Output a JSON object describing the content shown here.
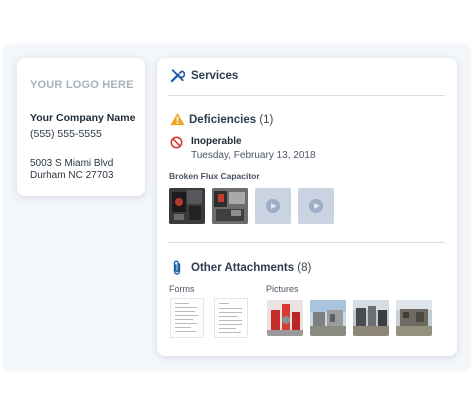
{
  "company": {
    "logo_placeholder": "YOUR LOGO HERE",
    "name": "Your Company Name",
    "phone": "(555) 555-5555",
    "address_line1": "5003 S Miami Blvd",
    "address_line2": "Durham NC 27703"
  },
  "services": {
    "title": "Services",
    "icon": "tools-icon"
  },
  "deficiencies": {
    "title": "Deficiencies",
    "count": "(1)",
    "icon": "warning-icon",
    "item": {
      "status": "Inoperable",
      "status_icon": "prohibited-icon",
      "date": "Tuesday, February 13, 2018",
      "label": "Broken Flux Capacitor",
      "media": [
        "photo",
        "photo",
        "video",
        "video"
      ]
    }
  },
  "attachments": {
    "title": "Other Attachments",
    "count": "(8)",
    "icon": "paperclip-icon",
    "forms_label": "Forms",
    "pictures_label": "Pictures",
    "forms_count": 2,
    "pictures_count": 4
  },
  "colors": {
    "accent": "#1f5fa8",
    "warning": "#f0a428",
    "danger": "#d33a3a",
    "heading": "#2d3d4f"
  }
}
